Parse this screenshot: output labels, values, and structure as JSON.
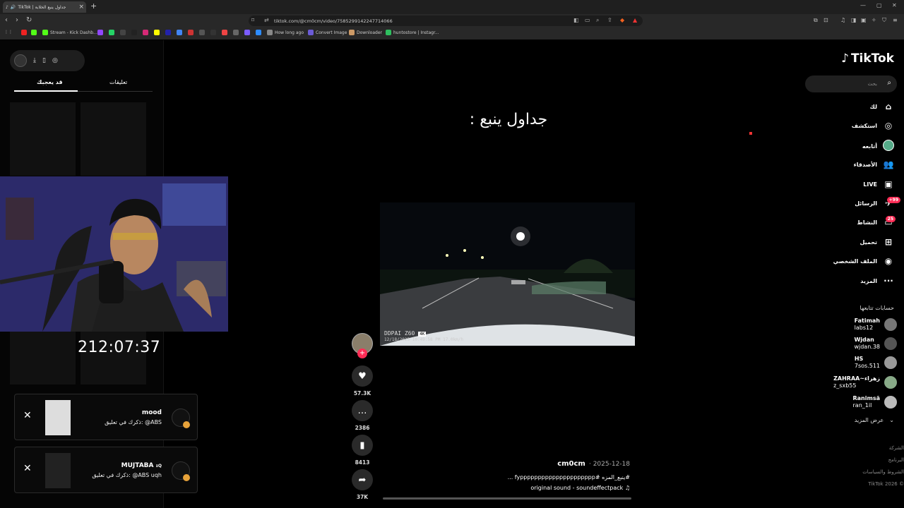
{
  "browser": {
    "tab_title": "TikTok | جداول ينبع الخلابة",
    "url": "tiktok.com/@cm0cm/video/7585299142247714066",
    "bookmarks": [
      "Stream - Kick Dashb...",
      "How long ago",
      "Convert Image",
      "Downloader",
      "huntostore | Instagr..."
    ]
  },
  "left_panel": {
    "tabs": [
      "تعليقات",
      "قد يعجبك"
    ],
    "timer": "212:07:37",
    "notifications": [
      {
        "name": "mood",
        "message": "ذكرك في تعليق: @ABS"
      },
      {
        "name": "MUJTABA",
        "name_suffix": "ɪQ",
        "message": "ذكرك في تعليق: @ABS uqh"
      }
    ]
  },
  "video": {
    "caption_overlay": "جداول ينبع :",
    "dashcam_brand": "DDPAI Z60",
    "dashcam_badge": "4K",
    "dashcam_timestamp": "12/18/2025 10:49:58 PM   17.0km/h",
    "author": "cm0cm",
    "date": "2025-12-18",
    "description": "#ينبع_المزه #fyppppppppppppppppppppp ...",
    "sound": "original sound - soundeffectpack",
    "actions": [
      {
        "icon": "heart-icon",
        "count": "57.3K"
      },
      {
        "icon": "comment-icon",
        "count": "2386"
      },
      {
        "icon": "bookmark-icon",
        "count": "8413"
      },
      {
        "icon": "share-icon",
        "count": "37K"
      }
    ]
  },
  "sidebar": {
    "logo": "TikTok",
    "search_placeholder": "بحث",
    "nav": [
      {
        "label": "لك",
        "icon": "home-icon"
      },
      {
        "label": "استكشف",
        "icon": "compass-icon"
      },
      {
        "label": "أتابعه",
        "icon": "following-avatar-icon"
      },
      {
        "label": "الأصدقاء",
        "icon": "friends-icon"
      },
      {
        "label": "LIVE",
        "icon": "live-icon"
      },
      {
        "label": "الرسائل",
        "icon": "messages-icon",
        "badge": "99+"
      },
      {
        "label": "النشاط",
        "icon": "activity-icon",
        "badge": "25"
      },
      {
        "label": "تحميل",
        "icon": "upload-icon"
      },
      {
        "label": "الملف الشخصي",
        "icon": "profile-icon"
      },
      {
        "label": "المزيد",
        "icon": "more-icon"
      }
    ],
    "following_title": "حسابات تتابعها",
    "following": [
      {
        "name": "Fatimah",
        "handle": "labs12"
      },
      {
        "name": "Wjdan",
        "handle": "wjdan.38"
      },
      {
        "name": "HS",
        "handle": "7sos.511"
      },
      {
        "name": "ZAHRAA~زهراء",
        "handle": "z_sxb55"
      },
      {
        "name": "Ranimsȃ",
        "handle": "ran_1il"
      }
    ],
    "show_more": "عرض المزيد",
    "footer": [
      "الشركة",
      "البرنامج",
      "الشروط والسياسات",
      "© 2026 TikTok"
    ]
  }
}
